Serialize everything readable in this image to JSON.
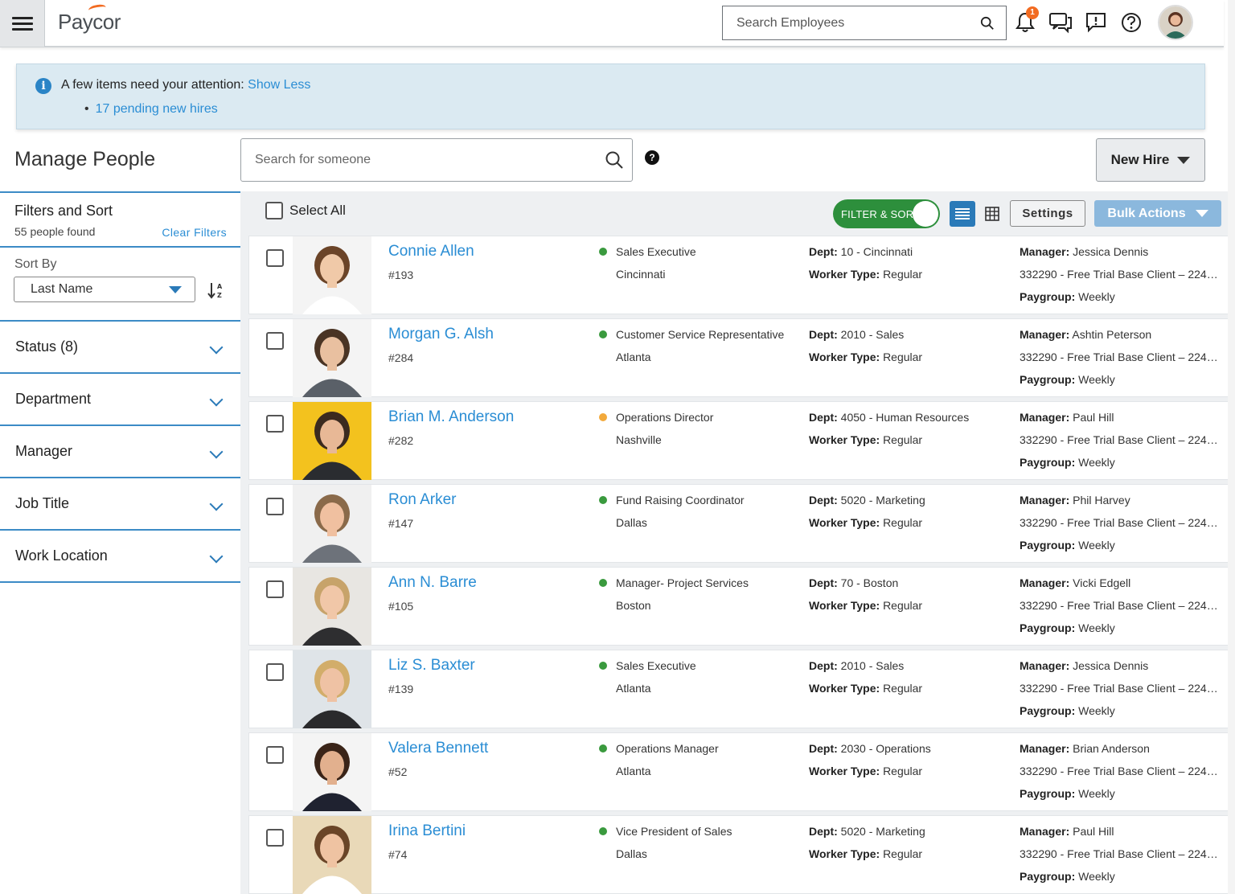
{
  "topbar": {
    "logo": "Paycor",
    "search_placeholder": "Search Employees",
    "notification_count": "1"
  },
  "alert": {
    "message": "A few items need your attention:",
    "toggle_link": "Show Less",
    "items": [
      "17 pending new hires"
    ]
  },
  "page": {
    "title": "Manage People",
    "search_placeholder": "Search for someone",
    "help": "?",
    "new_hire_label": "New Hire"
  },
  "sidebar": {
    "filters_title": "Filters and Sort",
    "count": "55 people found",
    "clear_filters": "Clear Filters",
    "sort_by_label": "Sort By",
    "sort_value": "Last Name",
    "facets": [
      "Status (8)",
      "Department",
      "Manager",
      "Job Title",
      "Work Location"
    ]
  },
  "toolbar": {
    "select_all": "Select All",
    "filter_toggle": "FILTER & SORT",
    "settings": "Settings",
    "bulk_actions": "Bulk Actions"
  },
  "labels": {
    "dept": "Dept:",
    "worker_type": "Worker Type:",
    "manager": "Manager:",
    "paygroup": "Paygroup:"
  },
  "colors": {
    "active_status": "#3a9a3e",
    "pending_status": "#f2a93b",
    "accent": "#2a8dd4"
  },
  "employees": [
    {
      "name": "Connie Allen",
      "id": "#193",
      "status": "active",
      "job": "Sales Executive",
      "location": "Cincinnati",
      "dept": "10 - Cincinnati",
      "worker_type": "Regular",
      "manager": "Jessica Dennis",
      "client": "332290 - Free Trial Base Client – 2244...",
      "paygroup": "Weekly"
    },
    {
      "name": "Morgan G. Alsh",
      "id": "#284",
      "status": "active",
      "job": "Customer Service Representative",
      "location": "Atlanta",
      "dept": "2010 - Sales",
      "worker_type": "Regular",
      "manager": "Ashtin Peterson",
      "client": "332290 - Free Trial Base Client – 2244...",
      "paygroup": "Weekly"
    },
    {
      "name": "Brian M. Anderson",
      "id": "#282",
      "status": "pending",
      "job": "Operations Director",
      "location": "Nashville",
      "dept": "4050 - Human Resources",
      "worker_type": "Regular",
      "manager": "Paul Hill",
      "client": "332290 - Free Trial Base Client – 2244...",
      "paygroup": "Weekly"
    },
    {
      "name": "Ron Arker",
      "id": "#147",
      "status": "active",
      "job": "Fund Raising Coordinator",
      "location": "Dallas",
      "dept": "5020 - Marketing",
      "worker_type": "Regular",
      "manager": "Phil Harvey",
      "client": "332290 - Free Trial Base Client – 2244...",
      "paygroup": "Weekly"
    },
    {
      "name": "Ann N. Barre",
      "id": "#105",
      "status": "active",
      "job": "Manager- Project Services",
      "location": "Boston",
      "dept": "70 - Boston",
      "worker_type": "Regular",
      "manager": "Vicki Edgell",
      "client": "332290 - Free Trial Base Client – 2244...",
      "paygroup": "Weekly"
    },
    {
      "name": "Liz S. Baxter",
      "id": "#139",
      "status": "active",
      "job": "Sales Executive",
      "location": "Atlanta",
      "dept": "2010 - Sales",
      "worker_type": "Regular",
      "manager": "Jessica Dennis",
      "client": "332290 - Free Trial Base Client – 2244...",
      "paygroup": "Weekly"
    },
    {
      "name": "Valera Bennett",
      "id": "#52",
      "status": "active",
      "job": "Operations Manager",
      "location": "Atlanta",
      "dept": "2030 - Operations",
      "worker_type": "Regular",
      "manager": "Brian Anderson",
      "client": "332290 - Free Trial Base Client – 2244...",
      "paygroup": "Weekly"
    },
    {
      "name": "Irina Bertini",
      "id": "#74",
      "status": "active",
      "job": "Vice President of Sales",
      "location": "Dallas",
      "dept": "5020 - Marketing",
      "worker_type": "Regular",
      "manager": "Paul Hill",
      "client": "332290 - Free Trial Base Client – 2244...",
      "paygroup": "Weekly"
    }
  ]
}
